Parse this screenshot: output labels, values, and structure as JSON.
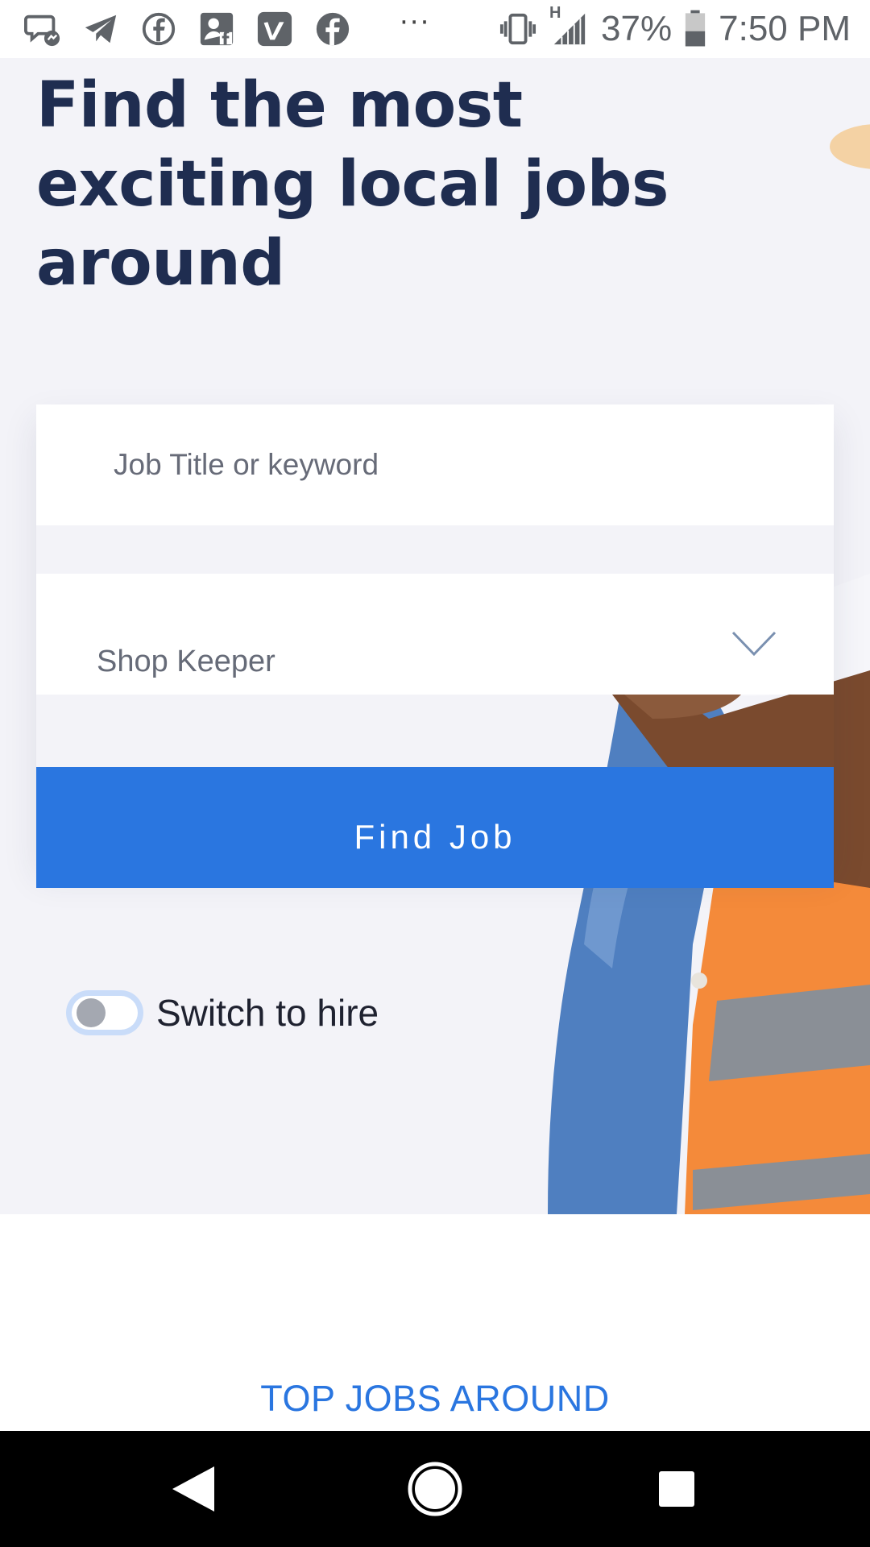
{
  "status_bar": {
    "notification_icons": [
      "messenger-icon",
      "telegram-icon",
      "facebook-icon",
      "facebook-photo-icon",
      "vimeo-icon",
      "facebook-icon"
    ],
    "overflow": "···",
    "network_type": "H",
    "battery": "37%",
    "time": "7:50 PM"
  },
  "hero": {
    "title": "Find the most exciting local jobs around"
  },
  "search": {
    "keyword_placeholder": "Job Title or keyword",
    "category_value": "Shop Keeper",
    "find_button": "Find Job"
  },
  "hire_toggle": {
    "label": "Switch to hire",
    "checked": false
  },
  "sections": {
    "top_jobs_heading": "TOP JOBS AROUND"
  },
  "colors": {
    "primary": "#2a76e0",
    "title": "#1f2d50",
    "hero_background": "#f3f3f8"
  }
}
